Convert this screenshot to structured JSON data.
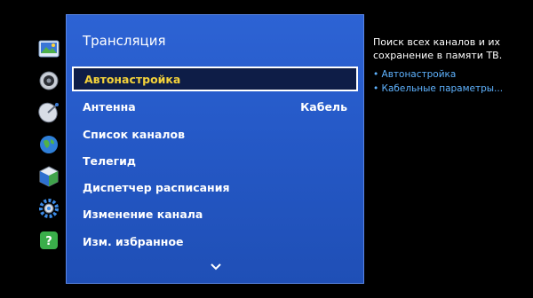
{
  "sidebar": {
    "icons": [
      "picture-icon",
      "sound-icon",
      "broadcast-icon",
      "network-icon",
      "system-icon",
      "support-icon",
      "smart-hub-icon"
    ]
  },
  "panel": {
    "title": "Трансляция",
    "items": [
      {
        "label": "Автонастройка",
        "value": ""
      },
      {
        "label": "Антенна",
        "value": "Кабель"
      },
      {
        "label": "Список каналов",
        "value": ""
      },
      {
        "label": "Телегид",
        "value": ""
      },
      {
        "label": "Диспетчер расписания",
        "value": ""
      },
      {
        "label": "Изменение канала",
        "value": ""
      },
      {
        "label": "Изм. избранное",
        "value": ""
      }
    ],
    "selected_index": 0
  },
  "info": {
    "description": "Поиск всех каналов и их сохранение в памяти ТВ.",
    "links": [
      "• Автонастройка",
      "• Кабельные параметры..."
    ]
  },
  "colors": {
    "panel_bg": "#2559c7",
    "selected_text": "#f4d23a",
    "link": "#5fb3ff"
  }
}
